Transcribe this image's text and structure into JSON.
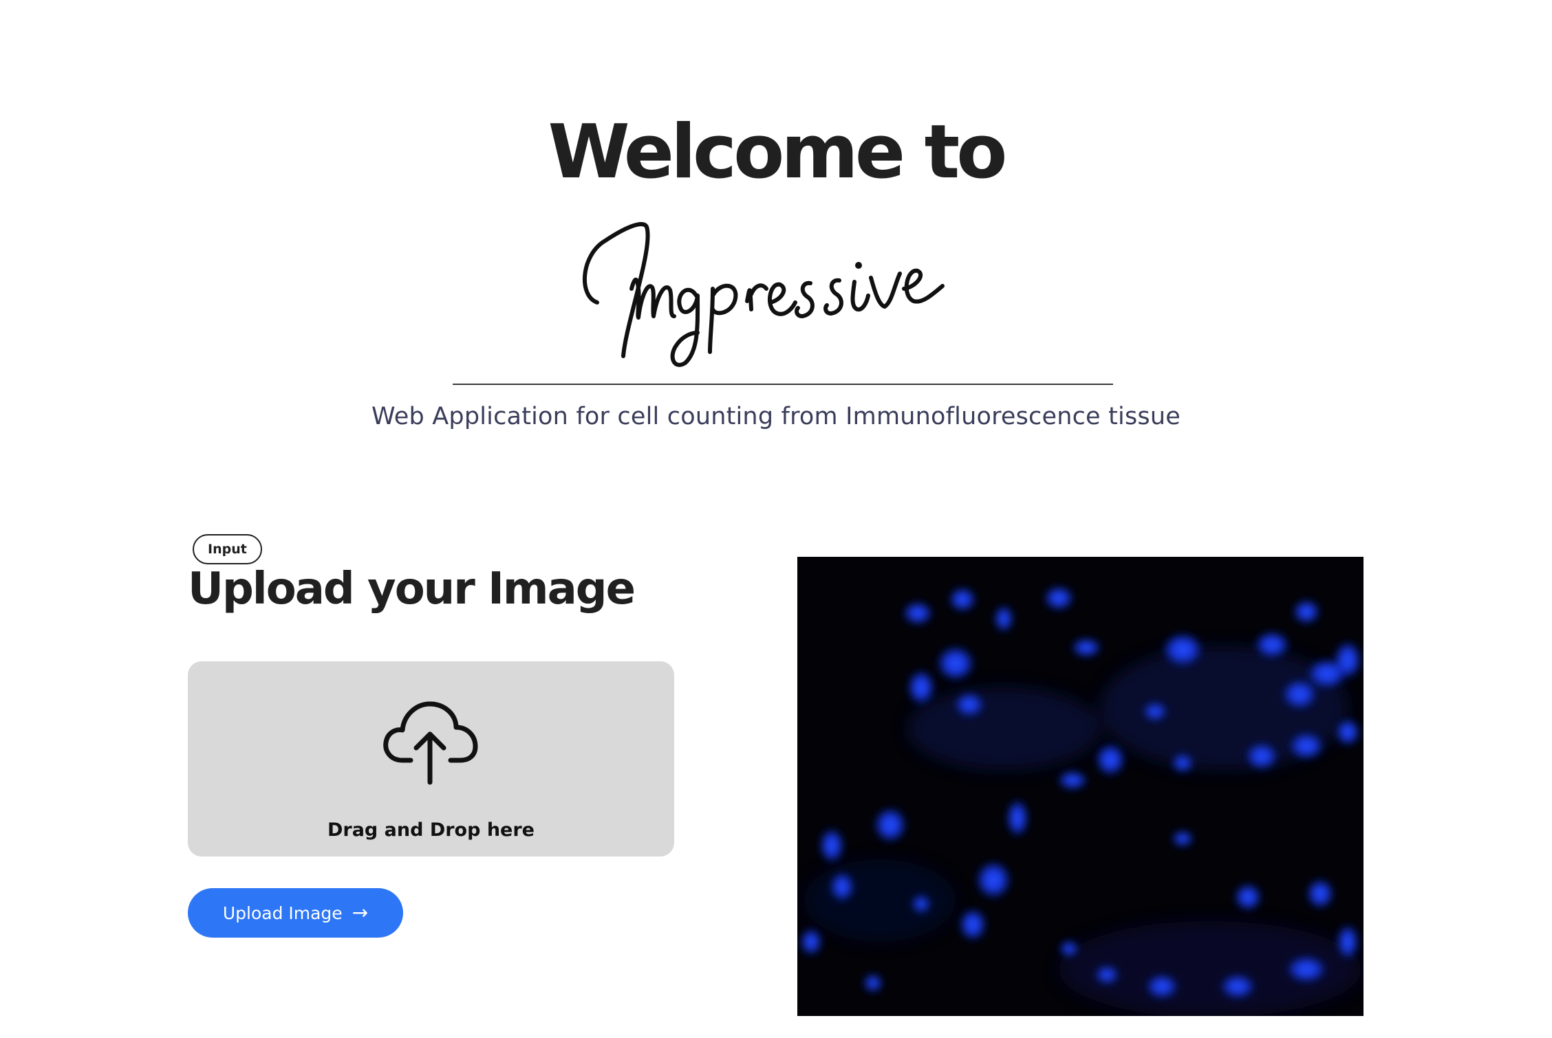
{
  "hero": {
    "title": "Welcome to",
    "brand": "Imgpressive",
    "subtitle": "Web Application for cell counting from Immunofluorescence tissue"
  },
  "upload": {
    "badge": "Input",
    "heading": "Upload your Image",
    "dropzone_label": "Drag and Drop here",
    "dropzone_icon": "cloud-upload-icon",
    "button_label": "Upload Image",
    "button_icon": "arrow-right-icon"
  },
  "preview": {
    "description": "fluorescence microscopy image of blue-stained cell nuclei on black background"
  },
  "colors": {
    "accent": "#2d76f5",
    "dropzone_bg": "#d9d9d9",
    "text_dark": "#202020",
    "subtitle": "#3a3d5a",
    "nuclei": "#1a3cff"
  }
}
